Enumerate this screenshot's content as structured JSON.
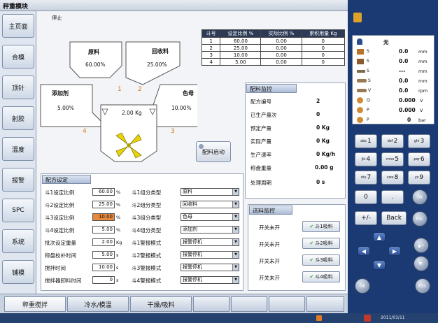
{
  "app_title": "秤重模块",
  "status": "停止",
  "nav": [
    "主页面",
    "合模",
    "顶针",
    "射胶",
    "温度",
    "报警",
    "SPC",
    "系统",
    "铺模"
  ],
  "hoppers": {
    "raw": {
      "label": "原料",
      "pct": "60.00%"
    },
    "recycle": {
      "label": "回收料",
      "pct": "25.00%"
    },
    "additive": {
      "label": "添加剂",
      "pct": "5.00%"
    },
    "color": {
      "label": "色母",
      "pct": "10.00%"
    },
    "weight": "2.00 Kg",
    "n1": "1",
    "n2": "2",
    "n3": "3",
    "n4": "4"
  },
  "material_table": {
    "headers": [
      "斗号",
      "设定比例 %",
      "实际比例 %",
      "累积用量 Kg"
    ],
    "rows": [
      [
        "1",
        "60.00",
        "0.00",
        "0"
      ],
      [
        "2",
        "25.00",
        "0.00",
        "0"
      ],
      [
        "3",
        "10.00",
        "0.00",
        "0"
      ],
      [
        "4",
        "5.00",
        "0.00",
        "0"
      ]
    ]
  },
  "start_button": "配料启动",
  "ratio_monitor": {
    "title": "配料监控",
    "items": [
      {
        "label": "配方编号",
        "value": "2"
      },
      {
        "label": "已生产量次",
        "value": "0"
      },
      {
        "label": "预定产量",
        "value": "0 Kg"
      },
      {
        "label": "实际产量",
        "value": "0 Kg"
      },
      {
        "label": "生产速率",
        "value": "0 Kg/h"
      },
      {
        "label": "称盘重量",
        "value": "0.00 g"
      },
      {
        "label": "处理周期",
        "value": "0 s"
      }
    ]
  },
  "recipe": {
    "title": "配方设定",
    "rows": [
      {
        "label": "斗1设定比例",
        "value": "60.00",
        "unit": "%",
        "type_label": "斗1组分类型",
        "type": "原料"
      },
      {
        "label": "斗2设定比例",
        "value": "25.00",
        "unit": "%",
        "type_label": "斗2组分类型",
        "type": "回收料"
      },
      {
        "label": "斗3设定比例",
        "value": "10.00",
        "unit": "%",
        "type_label": "斗3组分类型",
        "type": "色母"
      },
      {
        "label": "斗4设定比例",
        "value": "5.00",
        "unit": "%",
        "type_label": "斗4组分类型",
        "type": "添加剂"
      },
      {
        "label": "批次设定重量",
        "value": "2.00",
        "unit": "Kg",
        "type_label": "斗1警报模式",
        "type": "报警停机"
      },
      {
        "label": "称盘校补时间",
        "value": "5.00",
        "unit": "s",
        "type_label": "斗2警报模式",
        "type": "报警停机"
      },
      {
        "label": "搅拌时间",
        "value": "10.00",
        "unit": "s",
        "type_label": "斗3警报模式",
        "type": "报警停机"
      },
      {
        "label": "搅拌器卸料时间",
        "value": "0",
        "unit": "s",
        "type_label": "斗4警报模式",
        "type": "报警停机"
      }
    ]
  },
  "feed_monitor": {
    "title": "送料监控",
    "rows": [
      {
        "label": "开关未开",
        "button": "斗1吸料"
      },
      {
        "label": "开关未开",
        "button": "斗2吸料"
      },
      {
        "label": "开关未开",
        "button": "斗3吸料"
      },
      {
        "label": "开关未开",
        "button": "斗4吸料"
      }
    ]
  },
  "bottom_tabs": [
    "秤重搅拌",
    "冷水/模温",
    "干燥/吸料"
  ],
  "status_panel": {
    "rows": [
      {
        "icon": "person-icon",
        "label": "",
        "value": "无"
      },
      {
        "icon": "mold-icon",
        "label": "S",
        "value": "0.0",
        "unit": "mm"
      },
      {
        "icon": "injection-icon",
        "label": "S",
        "value": "0.0",
        "unit": "mm"
      },
      {
        "icon": "eject-icon",
        "label": "S",
        "value": "---",
        "unit": "mm"
      },
      {
        "icon": "screw-icon",
        "label": "S",
        "value": "0.0",
        "unit": "mm"
      },
      {
        "icon": "screw-icon",
        "label": "V",
        "value": "0.0",
        "unit": "rpm"
      },
      {
        "icon": "valve-icon",
        "label": "Q",
        "value": "0.000",
        "unit": "V"
      },
      {
        "icon": "valve-icon",
        "label": "P",
        "value": "0.000",
        "unit": "V"
      },
      {
        "icon": "valve-icon",
        "label": "P",
        "value": "0",
        "unit": "bar"
      }
    ]
  },
  "keypad": [
    {
      "sub": "abc",
      "main": "1"
    },
    {
      "sub": "def",
      "main": "2"
    },
    {
      "sub": "ghi",
      "main": "3"
    },
    {
      "sub": "jkl",
      "main": "4"
    },
    {
      "sub": "mno",
      "main": "5"
    },
    {
      "sub": "pqr",
      "main": "6"
    },
    {
      "sub": "stu",
      "main": "7"
    },
    {
      "sub": "vwx",
      "main": "8"
    },
    {
      "sub": "yz",
      "main": "9"
    },
    {
      "sub": "",
      "main": "0"
    },
    {
      "sub": "",
      "main": "."
    }
  ],
  "keys": {
    "ok": "OK",
    "back": "Back",
    "plusminus": "+/-",
    "esc": "ESC"
  },
  "taskbar": {
    "datetime": "2011/03/11"
  }
}
